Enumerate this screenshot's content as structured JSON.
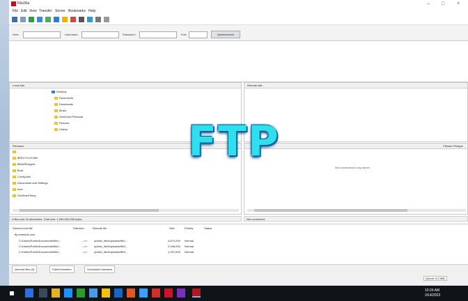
{
  "window": {
    "title": "FileZilla"
  },
  "menu": [
    "File",
    "Edit",
    "View",
    "Transfer",
    "Server",
    "Bookmarks",
    "Help"
  ],
  "quickconnect": {
    "host_label": "Host:",
    "username_label": "Username:",
    "password_label": "Password:",
    "port_label": "Port:",
    "button_label": "Quickconnect"
  },
  "local": {
    "site_label": "Local site:",
    "tree": [
      "Desktop",
      "Documents",
      "Downloads",
      "Music",
      "OneDrive-Personal",
      "Pictures",
      "Videos"
    ],
    "files_header": "Filename",
    "files": [
      "..",
      "$RECYCLE.BIN",
      "$WinREAgent",
      "Boot",
      "Config.Msi",
      "Documents and Settings",
      "Intel",
      "OneDriveTemp"
    ],
    "status": "4 files and 16 directories. Total size: 1,280,526,336 bytes"
  },
  "remote": {
    "site_label": "Remote site:",
    "files_header": "Filesize  Filetype",
    "empty_text": "Not connected to any server",
    "status": "Not connected."
  },
  "queue": {
    "columns": [
      "Server/Local file",
      "Direction",
      "Remote file",
      "Size",
      "Priority",
      "Status"
    ],
    "group": "ftp.example.com",
    "rows": [
      {
        "local": "C:\\Users\\Public\\Documents\\file1...",
        "dir": "-->>",
        "remote": "/public_html/uploads/file1...",
        "size": "4,873,294",
        "prio": "Normal"
      },
      {
        "local": "C:\\Users\\Public\\Documents\\file2...",
        "dir": "-->>",
        "remote": "/public_html/uploads/file2...",
        "size": "2,048,530",
        "prio": "Normal"
      },
      {
        "local": "C:\\Users\\Public\\Documents\\file3...",
        "dir": "-->>",
        "remote": "/public_html/uploads/file3...",
        "size": "1,297,815",
        "prio": "Normal"
      }
    ]
  },
  "queue_tabs": [
    "Queued files (3)",
    "Failed transfers",
    "Successful transfers"
  ],
  "bottom_status": "Queue: 8.2 MiB",
  "tray": {
    "time": "10:24 AM",
    "date": "3/14/2023"
  },
  "overlay": {
    "text": "FTP"
  },
  "colors": {
    "accent": "#b5161d",
    "overlay_text": "#2ee0ee",
    "overlay_shadow": "#1366b0",
    "taskbar": "#0f1419"
  }
}
